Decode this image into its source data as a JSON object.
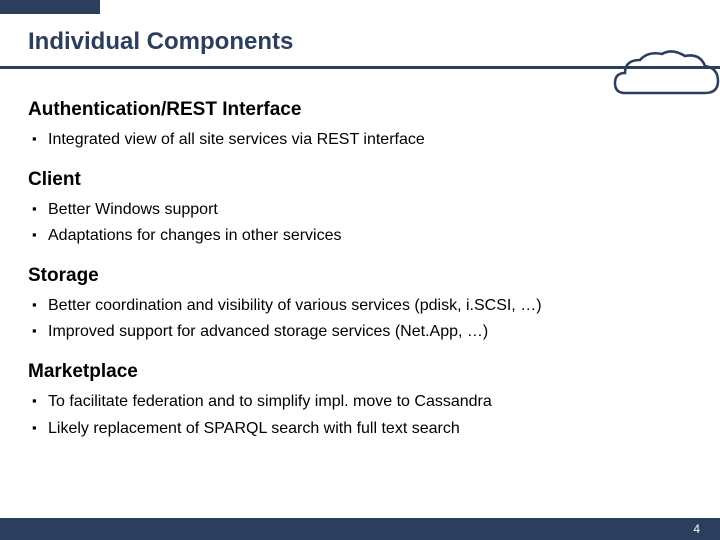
{
  "slide": {
    "title": "Individual Components",
    "pageNumber": "4"
  },
  "sections": [
    {
      "heading": "Authentication/REST Interface",
      "items": [
        "Integrated view of all site services via REST interface"
      ]
    },
    {
      "heading": "Client",
      "items": [
        "Better Windows support",
        "Adaptations for changes in other services"
      ]
    },
    {
      "heading": "Storage",
      "items": [
        "Better coordination and visibility of various services (pdisk, i.SCSI, …)",
        "Improved support for advanced storage services (Net.App, …)"
      ]
    },
    {
      "heading": "Marketplace",
      "items": [
        "To facilitate federation and to simplify impl. move to Cassandra",
        "Likely replacement of SPARQL search with full text search"
      ]
    }
  ]
}
